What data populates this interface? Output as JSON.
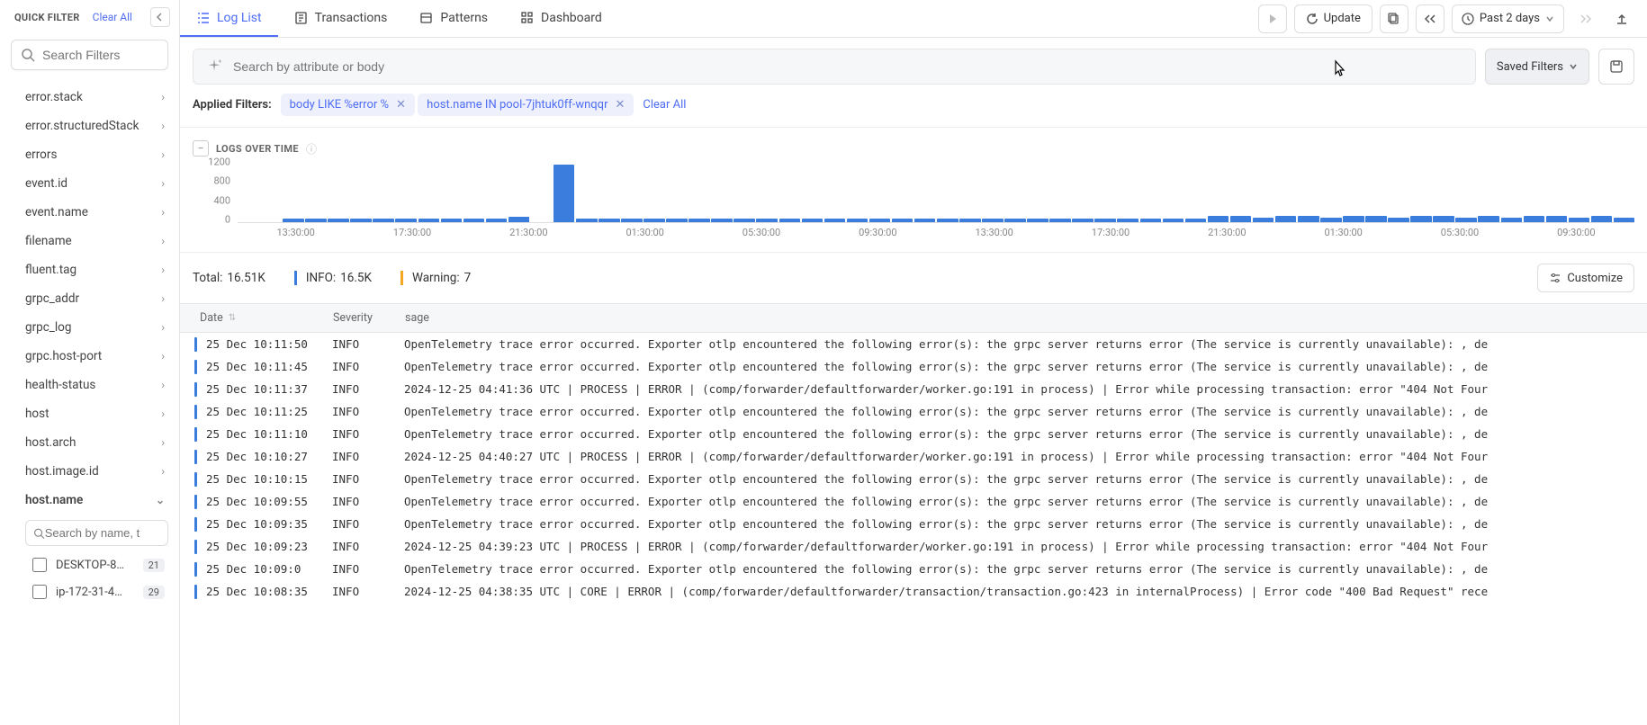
{
  "sidebar": {
    "title": "QUICK FILTER",
    "clear_all": "Clear All",
    "search_placeholder": "Search Filters",
    "items": [
      {
        "label": "error.stack"
      },
      {
        "label": "error.structuredStack"
      },
      {
        "label": "errors"
      },
      {
        "label": "event.id"
      },
      {
        "label": "event.name"
      },
      {
        "label": "filename"
      },
      {
        "label": "fluent.tag"
      },
      {
        "label": "grpc_addr"
      },
      {
        "label": "grpc_log"
      },
      {
        "label": "grpc.host-port"
      },
      {
        "label": "health-status"
      },
      {
        "label": "host"
      },
      {
        "label": "host.arch"
      },
      {
        "label": "host.image.id"
      },
      {
        "label": "host.name"
      }
    ],
    "sub_search_placeholder": "Search by name, t",
    "checks": [
      {
        "label": "DESKTOP-8…",
        "count": "21"
      },
      {
        "label": "ip-172-31-4…",
        "count": "29"
      }
    ]
  },
  "tabs": [
    {
      "label": "Log List"
    },
    {
      "label": "Transactions"
    },
    {
      "label": "Patterns"
    },
    {
      "label": "Dashboard"
    }
  ],
  "toolbar": {
    "update": "Update",
    "time_range": "Past 2 days"
  },
  "search": {
    "placeholder": "Search by attribute or body",
    "saved_filters": "Saved Filters"
  },
  "applied": {
    "label": "Applied Filters:",
    "chips": [
      "body LIKE %error %",
      "host.name IN pool-7jhtuk0ff-wnqqr"
    ],
    "clear": "Clear All"
  },
  "chart_section": {
    "title": "LOGS OVER TIME"
  },
  "chart_data": {
    "type": "bar",
    "title": "LOGS OVER TIME",
    "ylabel": "",
    "xlabel": "",
    "ylim": [
      0,
      1200
    ],
    "y_ticks": [
      0,
      400,
      800,
      1200
    ],
    "x_ticks": [
      "13:30:00",
      "17:30:00",
      "21:30:00",
      "01:30:00",
      "05:30:00",
      "09:30:00",
      "13:30:00",
      "17:30:00",
      "21:30:00",
      "01:30:00",
      "05:30:00",
      "09:30:00"
    ],
    "values": [
      0,
      0,
      70,
      70,
      70,
      70,
      70,
      70,
      70,
      70,
      70,
      70,
      110,
      0,
      1200,
      70,
      70,
      70,
      70,
      70,
      70,
      70,
      70,
      70,
      70,
      70,
      70,
      70,
      70,
      70,
      70,
      70,
      70,
      70,
      70,
      70,
      70,
      70,
      70,
      70,
      70,
      70,
      70,
      130,
      130,
      100,
      130,
      130,
      100,
      130,
      130,
      100,
      130,
      130,
      100,
      130,
      100,
      130,
      130,
      100,
      130,
      100
    ]
  },
  "stats": {
    "total_label": "Total:",
    "total_value": "16.51K",
    "info_label": "INFO:",
    "info_value": "16.5K",
    "warn_label": "Warning:",
    "warn_value": "7",
    "customize": "Customize"
  },
  "table": {
    "headers": {
      "date": "Date",
      "severity": "Severity",
      "message": "sage"
    },
    "rows": [
      {
        "date": "25 Dec 10:11:50",
        "sev": "INFO",
        "msg": "OpenTelemetry trace error occurred. Exporter otlp encountered the following error(s): the grpc server returns error (The service is currently unavailable): , de"
      },
      {
        "date": "25 Dec 10:11:45",
        "sev": "INFO",
        "msg": "OpenTelemetry trace error occurred. Exporter otlp encountered the following error(s): the grpc server returns error (The service is currently unavailable): , de"
      },
      {
        "date": "25 Dec 10:11:37",
        "sev": "INFO",
        "msg": "2024-12-25 04:41:36 UTC | PROCESS | ERROR | (comp/forwarder/defaultforwarder/worker.go:191 in process) | Error while processing transaction: error \"404 Not Four"
      },
      {
        "date": "25 Dec 10:11:25",
        "sev": "INFO",
        "msg": "OpenTelemetry trace error occurred. Exporter otlp encountered the following error(s): the grpc server returns error (The service is currently unavailable): , de"
      },
      {
        "date": "25 Dec 10:11:10",
        "sev": "INFO",
        "msg": "OpenTelemetry trace error occurred. Exporter otlp encountered the following error(s): the grpc server returns error (The service is currently unavailable): , de"
      },
      {
        "date": "25 Dec 10:10:27",
        "sev": "INFO",
        "msg": "2024-12-25 04:40:27 UTC | PROCESS | ERROR | (comp/forwarder/defaultforwarder/worker.go:191 in process) | Error while processing transaction: error \"404 Not Four"
      },
      {
        "date": "25 Dec 10:10:15",
        "sev": "INFO",
        "msg": "OpenTelemetry trace error occurred. Exporter otlp encountered the following error(s): the grpc server returns error (The service is currently unavailable): , de"
      },
      {
        "date": "25 Dec 10:09:55",
        "sev": "INFO",
        "msg": "OpenTelemetry trace error occurred. Exporter otlp encountered the following error(s): the grpc server returns error (The service is currently unavailable): , de"
      },
      {
        "date": "25 Dec 10:09:35",
        "sev": "INFO",
        "msg": "OpenTelemetry trace error occurred. Exporter otlp encountered the following error(s): the grpc server returns error (The service is currently unavailable): , de"
      },
      {
        "date": "25 Dec 10:09:23",
        "sev": "INFO",
        "msg": "2024-12-25 04:39:23 UTC | PROCESS | ERROR | (comp/forwarder/defaultforwarder/worker.go:191 in process) | Error while processing transaction: error \"404 Not Four"
      },
      {
        "date": "25 Dec 10:09:0",
        "sev": "INFO",
        "msg": "OpenTelemetry trace error occurred. Exporter otlp encountered the following error(s): the grpc server returns error (The service is currently unavailable): , de"
      },
      {
        "date": "25 Dec 10:08:35",
        "sev": "INFO",
        "msg": "2024-12-25 04:38:35 UTC | CORE | ERROR | (comp/forwarder/defaultforwarder/transaction/transaction.go:423 in internalProcess) | Error code \"400 Bad Request\" rece"
      }
    ]
  }
}
